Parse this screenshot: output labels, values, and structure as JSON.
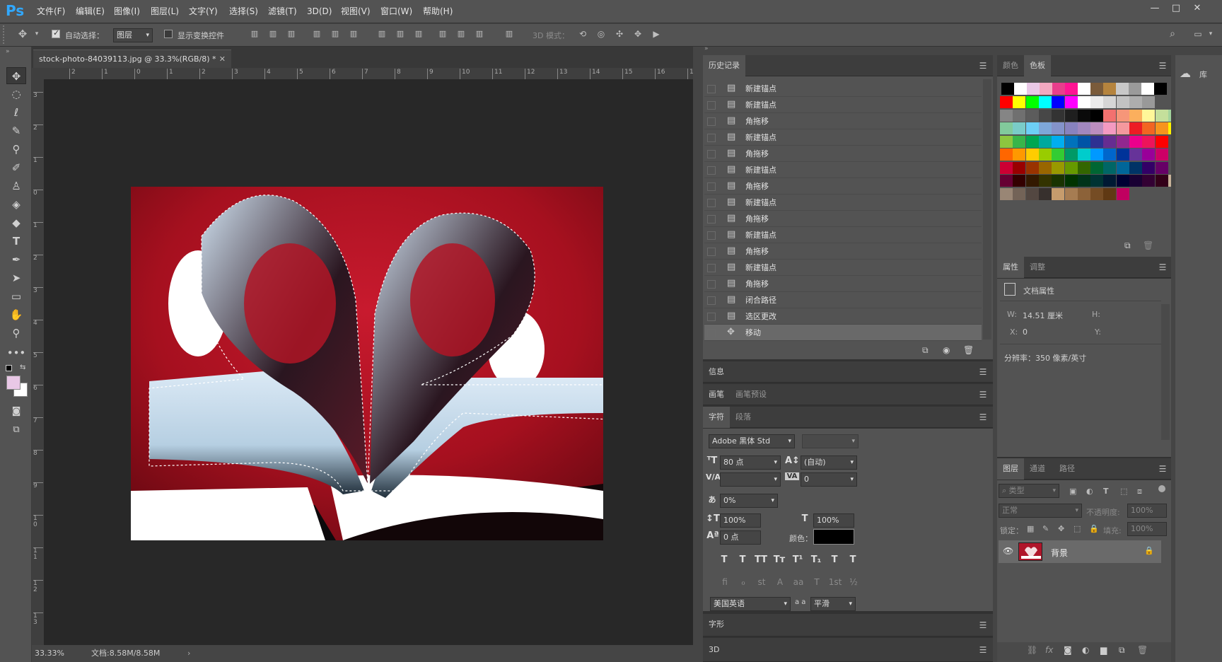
{
  "app": {
    "logo": "Ps"
  },
  "menu": [
    "文件(F)",
    "编辑(E)",
    "图像(I)",
    "图层(L)",
    "文字(Y)",
    "选择(S)",
    "滤镜(T)",
    "3D(D)",
    "视图(V)",
    "窗口(W)",
    "帮助(H)"
  ],
  "window_controls": {
    "minimize": "—",
    "maximize": "□",
    "close": "✕"
  },
  "options": {
    "auto_select_label": "自动选择：",
    "auto_select_checked": true,
    "auto_select_target": "图层",
    "show_transform_label": "显示变换控件",
    "show_transform_checked": false,
    "mode_3d_label": "3D 模式："
  },
  "document": {
    "tab_title": "stock-photo-84039113.jpg @ 33.3%(RGB/8) *",
    "zoom": "33.33%",
    "doc_size": "文档:8.58M/8.58M"
  },
  "rulers": {
    "h_ticks": [
      "2",
      "1",
      "0",
      "1",
      "2",
      "3",
      "4",
      "5",
      "6",
      "7",
      "8",
      "9",
      "10",
      "11",
      "12",
      "13",
      "14",
      "15",
      "16",
      "1"
    ],
    "v_ticks": [
      "3",
      "2",
      "1",
      "0",
      "1",
      "2",
      "3",
      "4",
      "5",
      "6",
      "7",
      "8",
      "9",
      "1 0",
      "1 1",
      "1 2",
      "1 3"
    ]
  },
  "history": {
    "tab": "历史记录",
    "items": [
      {
        "label": "新建锚点",
        "icon": "doc-icon"
      },
      {
        "label": "新建锚点",
        "icon": "doc-icon"
      },
      {
        "label": "角拖移",
        "icon": "doc-icon"
      },
      {
        "label": "新建锚点",
        "icon": "doc-icon"
      },
      {
        "label": "角拖移",
        "icon": "doc-icon"
      },
      {
        "label": "新建锚点",
        "icon": "doc-icon"
      },
      {
        "label": "角拖移",
        "icon": "doc-icon"
      },
      {
        "label": "新建锚点",
        "icon": "doc-icon"
      },
      {
        "label": "角拖移",
        "icon": "doc-icon"
      },
      {
        "label": "新建锚点",
        "icon": "doc-icon"
      },
      {
        "label": "角拖移",
        "icon": "doc-icon"
      },
      {
        "label": "新建锚点",
        "icon": "doc-icon"
      },
      {
        "label": "角拖移",
        "icon": "doc-icon"
      },
      {
        "label": "闭合路径",
        "icon": "doc-icon"
      },
      {
        "label": "选区更改",
        "icon": "doc-icon"
      },
      {
        "label": "移动",
        "icon": "move-icon"
      }
    ],
    "selected_index": 15
  },
  "panels": {
    "info": "信息",
    "brush": "画笔",
    "brush_presets": "画笔预设",
    "character": "字符",
    "paragraph": "段落",
    "glyphs": "字形",
    "threed": "3D"
  },
  "character": {
    "font_family": "Adobe 黑体 Std",
    "font_style": "",
    "font_size": "80 点",
    "leading": "(自动)",
    "kerning": "",
    "tracking": "0",
    "tsume": "0%",
    "vscale": "100%",
    "hscale": "100%",
    "baseline": "0 点",
    "color_label": "颜色：",
    "color": "#000000",
    "language": "美国英语",
    "aa_label": "a a",
    "antialias": "平滑",
    "style_buttons": [
      "T",
      "T",
      "TT",
      "Tт",
      "T¹",
      "T₁",
      "T",
      "T"
    ],
    "ot_buttons": [
      "fi",
      "ℴ",
      "st",
      "A",
      "aa",
      "T",
      "1st",
      "½"
    ]
  },
  "swatches_panel": {
    "tab_color": "颜色",
    "tab_swatches": "色板"
  },
  "properties": {
    "tab": "属性",
    "tab_adjust": "调整",
    "doc_props": "文档属性",
    "w_label": "W:",
    "w_value": "14.51 厘米",
    "h_label": "H:",
    "x_label": "X:",
    "x_value": "0",
    "y_label": "Y:",
    "resolution": "分辨率：350 像素/英寸"
  },
  "layers": {
    "tab_layers": "图层",
    "tab_channels": "通道",
    "tab_paths": "路径",
    "kind": "类型",
    "blend": "正常",
    "opacity_label": "不透明度:",
    "opacity": "100%",
    "lock_label": "锁定：",
    "fill_label": "填充:",
    "fill": "100%",
    "layer_name": "背景"
  },
  "library": {
    "label": "库"
  },
  "colors": {
    "ui_bg": "#535353",
    "selected_row": "#696969",
    "accent": "#31a8ff",
    "fg_color": "#e9c8e6",
    "bg_color": "#ffffff"
  },
  "swatch_colors": [
    [
      "#000000",
      "#ffffff",
      "#e9c8e6",
      "#f2a8c0",
      "#e83e8c",
      "#ff1493",
      "#ffffff",
      "#7a5b3a",
      "#b5843e",
      "#c8c8c8",
      "#9a9a9a",
      "#ffffff",
      "#000000"
    ],
    [
      "#ff0000",
      "#ffff00",
      "#00ff00",
      "#00ffff",
      "#0000ff",
      "#ff00ff",
      "#ffffff",
      "#ebebeb",
      "#d6d6d6",
      "#c2c2c2",
      "#adadad",
      "#999999"
    ],
    [
      "#858585",
      "#707070",
      "#5c5c5c",
      "#474747",
      "#333333",
      "#1f1f1f",
      "#0a0a0a",
      "#000000",
      "#f2716f",
      "#f69679",
      "#fbaf5d",
      "#fff799",
      "#c4df9b",
      "#a2d39c"
    ],
    [
      "#82ca9c",
      "#7accc8",
      "#6dcff6",
      "#7ea7d8",
      "#8493ca",
      "#8882be",
      "#a187be",
      "#bc8dbf",
      "#f49ac1",
      "#f5989d",
      "#ed1c24",
      "#f26522",
      "#f7941d",
      "#fff200"
    ],
    [
      "#8dc63f",
      "#39b54a",
      "#00a651",
      "#00a99d",
      "#00aeef",
      "#0072bc",
      "#0054a6",
      "#2e3192",
      "#662d91",
      "#92278f",
      "#ec008c",
      "#ed145b",
      "#ff0000"
    ],
    [
      "#ff6600",
      "#ff9900",
      "#ffcc00",
      "#99cc00",
      "#33cc33",
      "#009966",
      "#00cccc",
      "#0099ff",
      "#0066cc",
      "#003399",
      "#663399",
      "#990099",
      "#cc0066"
    ],
    [
      "#cc0033",
      "#990000",
      "#993300",
      "#996600",
      "#999900",
      "#669900",
      "#336600",
      "#006633",
      "#006666",
      "#006699",
      "#003366",
      "#330066",
      "#660066"
    ],
    [
      "#660033",
      "#330000",
      "#331900",
      "#333300",
      "#193300",
      "#003300",
      "#003319",
      "#003333",
      "#001933",
      "#000033",
      "#190033",
      "#330033",
      "#330019",
      "#c7b299"
    ],
    [
      "#998675",
      "#736357",
      "#534741",
      "#37302d",
      "#c69c6d",
      "#a67c52",
      "#8c6239",
      "#754c24",
      "#603913",
      "#c00060"
    ]
  ]
}
